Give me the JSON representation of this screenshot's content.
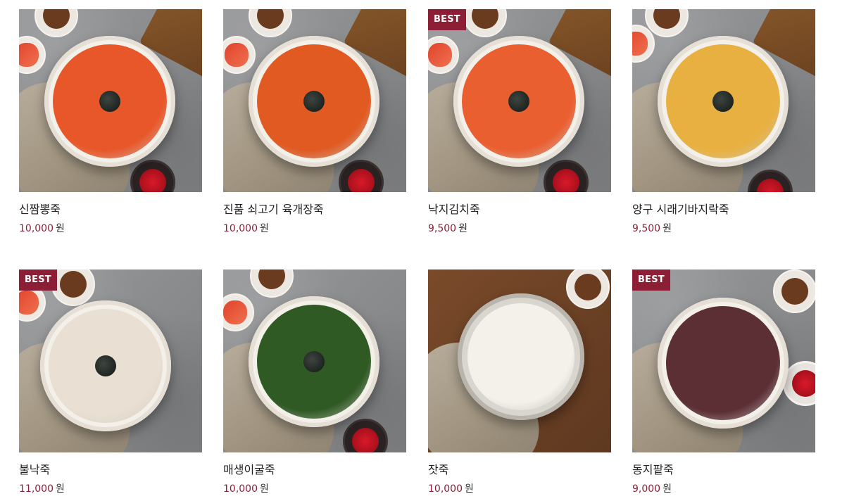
{
  "products": [
    {
      "name": "신짬뽕죽",
      "price": "10,000",
      "currency": "원",
      "badge": "",
      "porridge_color": "#e8572a",
      "icon": "spicy-seafood-porridge-image"
    },
    {
      "name": "진품 쇠고기 육개장죽",
      "price": "10,000",
      "currency": "원",
      "badge": "",
      "porridge_color": "#e05a22",
      "icon": "beef-yukgaejang-porridge-image"
    },
    {
      "name": "낙지김치죽",
      "price": "9,500",
      "currency": "원",
      "badge": "BEST",
      "porridge_color": "#ea5f30",
      "icon": "octopus-kimchi-porridge-image"
    },
    {
      "name": "양구 시래기바지락죽",
      "price": "9,500",
      "currency": "원",
      "badge": "",
      "porridge_color": "#e8b040",
      "icon": "clam-radish-greens-porridge-image"
    },
    {
      "name": "불낙죽",
      "price": "11,000",
      "currency": "원",
      "badge": "BEST",
      "porridge_color": "#e9dfd2",
      "icon": "bulgogi-octopus-porridge-image"
    },
    {
      "name": "매생이굴죽",
      "price": "10,000",
      "currency": "원",
      "badge": "",
      "porridge_color": "#2f5a24",
      "icon": "seaweed-oyster-porridge-image"
    },
    {
      "name": "잣죽",
      "price": "10,000",
      "currency": "원",
      "badge": "",
      "porridge_color": "#f4f1ea",
      "icon": "pine-nut-porridge-image"
    },
    {
      "name": "동지팥죽",
      "price": "9,000",
      "currency": "원",
      "badge": "BEST",
      "porridge_color": "#5c2f35",
      "icon": "red-bean-porridge-image"
    }
  ]
}
